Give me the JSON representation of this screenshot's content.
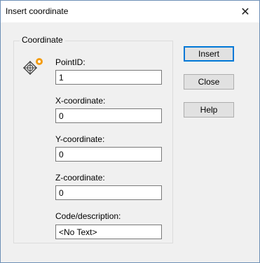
{
  "window": {
    "title": "Insert coordinate",
    "close_glyph": "✕"
  },
  "group": {
    "legend": "Coordinate",
    "icon": "coordinate-target-icon"
  },
  "fields": [
    {
      "label": "PointID:",
      "value": "1"
    },
    {
      "label": "X-coordinate:",
      "value": "0"
    },
    {
      "label": "Y-coordinate:",
      "value": "0"
    },
    {
      "label": "Z-coordinate:",
      "value": "0"
    },
    {
      "label": "Code/description:",
      "value": "<No Text>"
    }
  ],
  "buttons": {
    "insert": "Insert",
    "close": "Close",
    "help": "Help"
  },
  "colors": {
    "accent": "#0078d7",
    "icon_orange": "#f39c12"
  }
}
